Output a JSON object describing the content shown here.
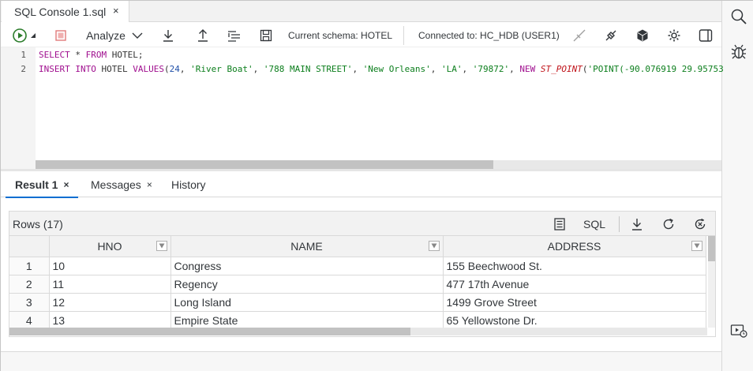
{
  "editor_tab": {
    "title": "SQL Console 1.sql",
    "close": "×"
  },
  "toolbar": {
    "analyze_label": "Analyze",
    "schema_text": "Current schema: HOTEL",
    "connection_text": "Connected to: HC_HDB (USER1)"
  },
  "editor": {
    "lines": [
      {
        "no": "1"
      },
      {
        "no": "2"
      }
    ],
    "line1": {
      "kw1": "SELECT",
      "star": " * ",
      "kw2": "FROM",
      "rest": " HOTEL;"
    },
    "line2": {
      "kw1": "INSERT",
      "kw2": "INTO",
      "table": " HOTEL ",
      "kw3": "VALUES",
      "p1": "(",
      "n1": "24",
      "c1": ", ",
      "s1": "'River Boat'",
      "c2": ", ",
      "s2": "'788 MAIN STREET'",
      "c3": ", ",
      "s3": "'New Orleans'",
      "c4": ", ",
      "s4": "'LA'",
      "c5": ", ",
      "s5": "'79872'",
      "c6": ", ",
      "kw4": "NEW",
      "sp": " ",
      "fn": "ST_POINT",
      "p2": "(",
      "s6": "'POINT(-90.076919 29.95753"
    }
  },
  "result_tabs": [
    {
      "label": "Result 1",
      "close": "×"
    },
    {
      "label": "Messages",
      "close": "×"
    },
    {
      "label": "History"
    }
  ],
  "result": {
    "rows_label": "Rows (17)",
    "sql_label": "SQL",
    "columns": [
      "HNO",
      "NAME",
      "ADDRESS"
    ],
    "rows": [
      {
        "idx": "1",
        "hno": "10",
        "name": "Congress",
        "address": "155 Beechwood St."
      },
      {
        "idx": "2",
        "hno": "11",
        "name": "Regency",
        "address": "477 17th Avenue"
      },
      {
        "idx": "3",
        "hno": "12",
        "name": "Long Island",
        "address": "1499 Grove Street"
      },
      {
        "idx": "4",
        "hno": "13",
        "name": "Empire State",
        "address": "65 Yellowstone Dr."
      }
    ]
  },
  "icons": {
    "run": "run-icon",
    "stop": "stop-icon",
    "download": "download-icon",
    "upload": "upload-icon",
    "format": "format-icon",
    "save": "save-icon",
    "search": "search-icon",
    "debug": "bug-icon"
  },
  "colors": {
    "accent": "#0a6ed1",
    "run_green": "#2b7c2b",
    "stop_red": "#e07a7a",
    "keyword": "#a00f8f",
    "string": "#0b7e1c",
    "number": "#1f4fa8",
    "function": "#c0141b"
  }
}
